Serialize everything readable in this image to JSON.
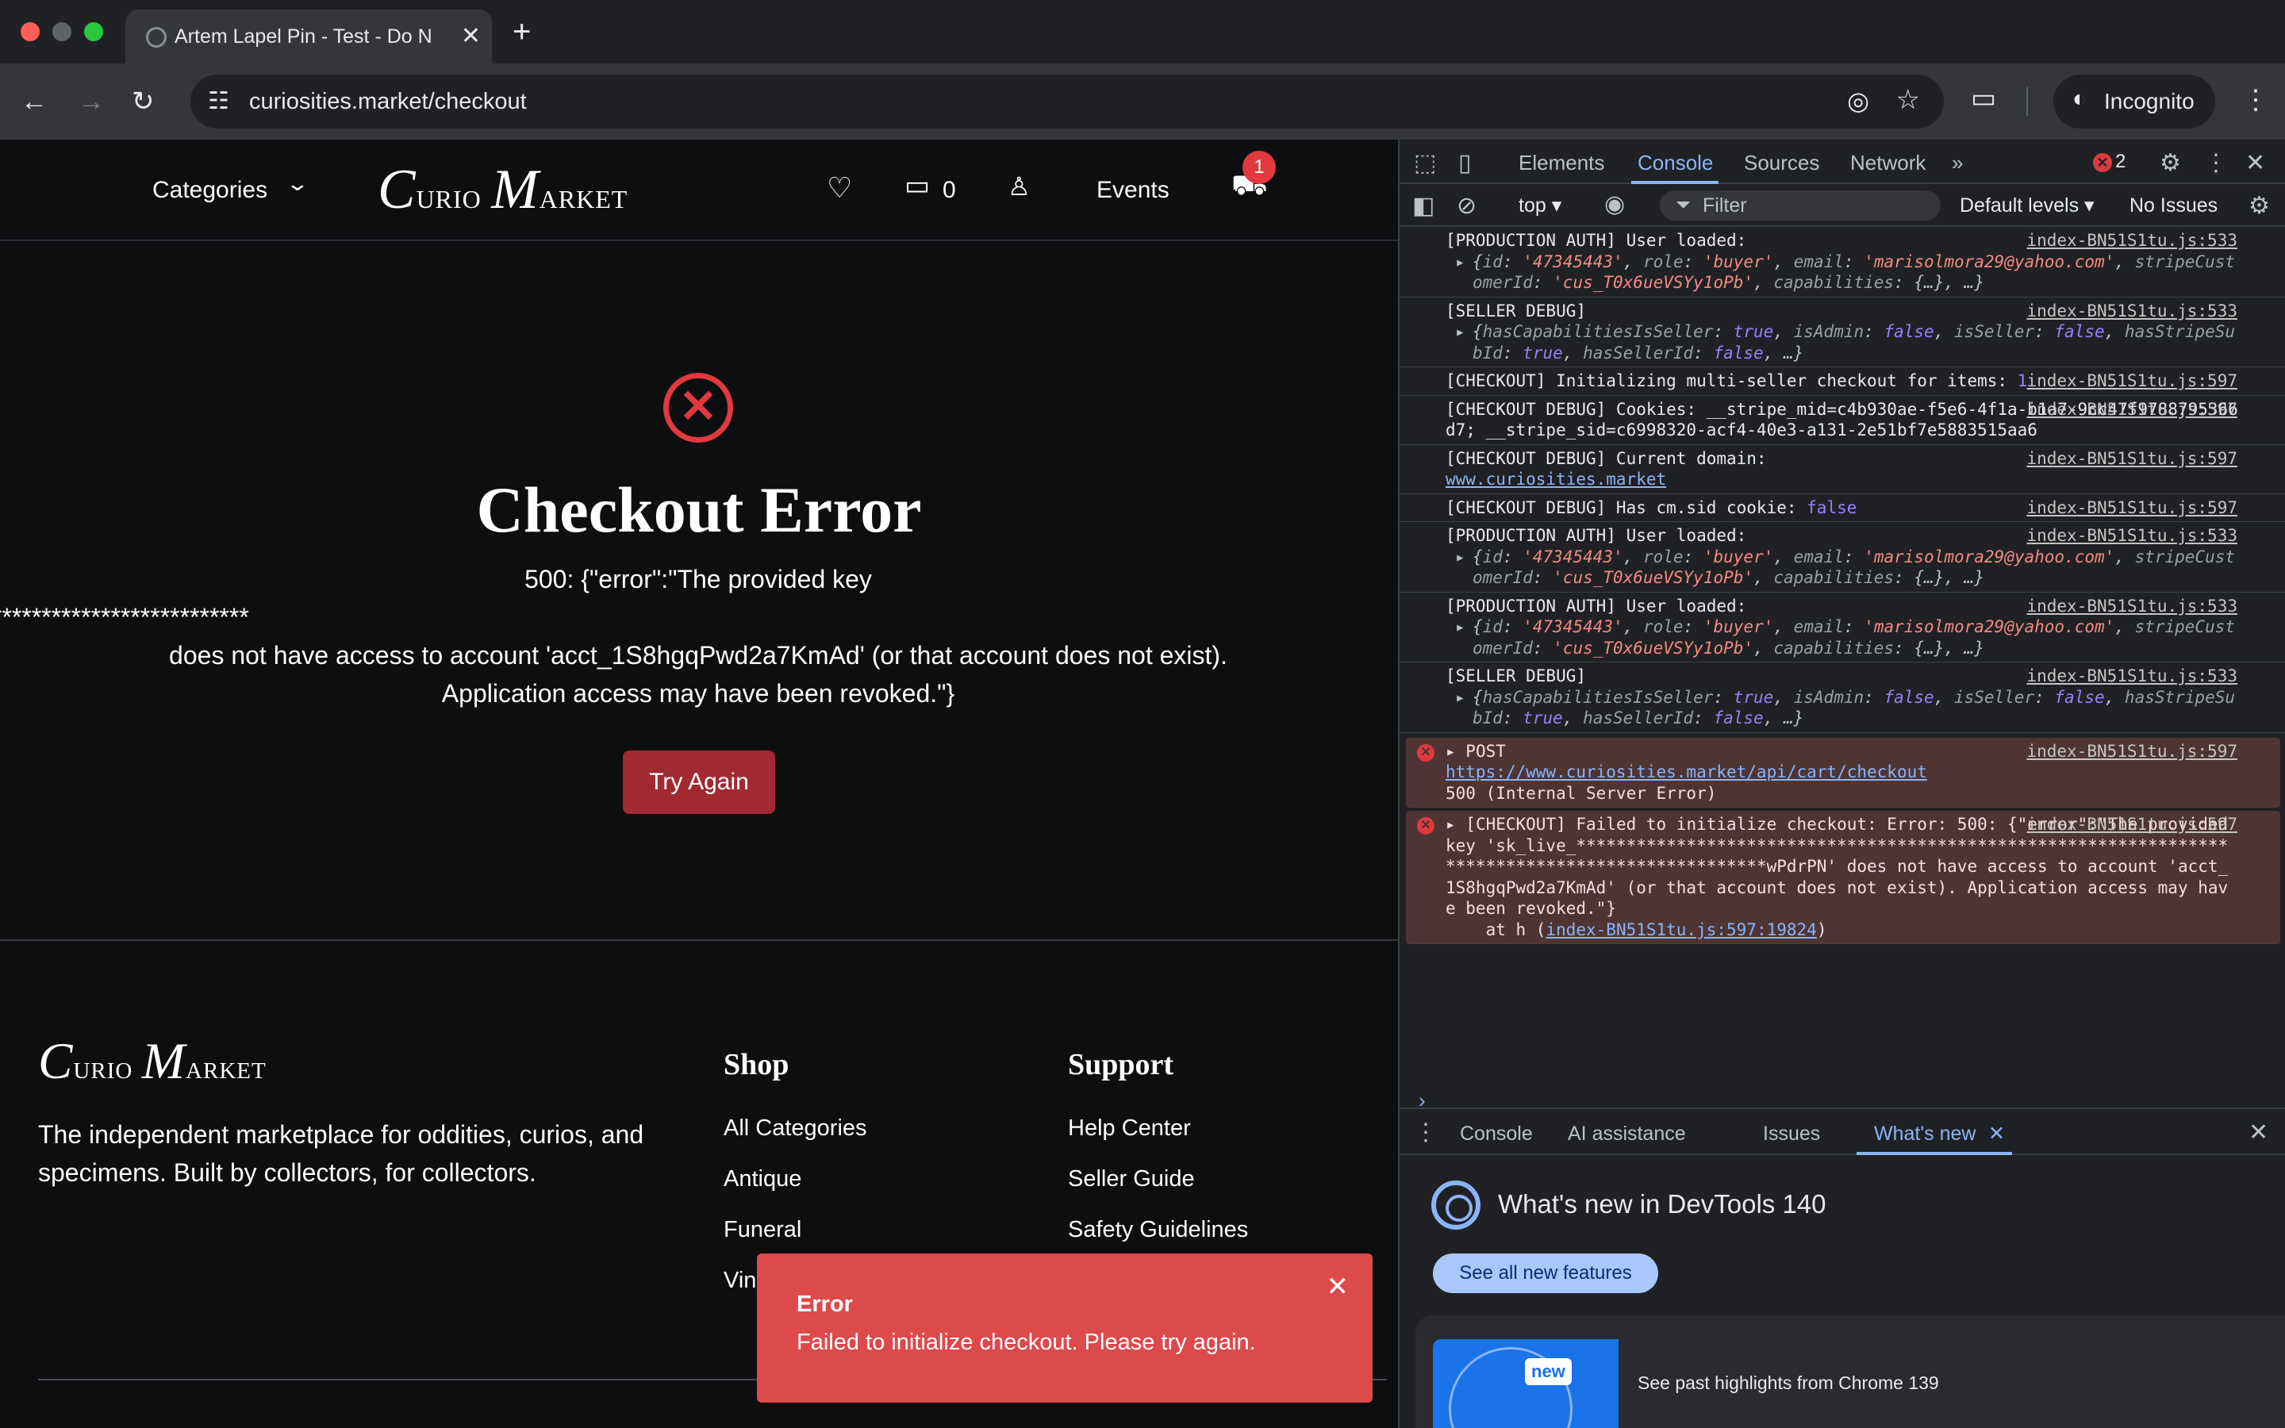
{
  "browser": {
    "tab_title": "Artem Lapel Pin - Test - Do N",
    "url": "curiosities.market/checkout",
    "incognito_label": "Incognito"
  },
  "site": {
    "nav": {
      "categories": "Categories",
      "logo": {
        "c1": "C",
        "rest1": "urio ",
        "c2": "M",
        "rest2": "arket"
      },
      "messages_count": "0",
      "events": "Events",
      "cart_count": "1"
    },
    "error": {
      "title": "Checkout Error",
      "message_line1": "500: {\"error\":\"The provided key",
      "message_line2": "'sk_live_************************************************************************************",
      "message_line3": "does not have access to account 'acct_1S8hgqPwd2a7KmAd' (or that account does not exist).",
      "message_line4": "Application access may have been revoked.\"}",
      "try_again": "Try Again"
    },
    "footer": {
      "tagline": "The independent marketplace for oddities, curios, and specimens. Built by collectors, for collectors.",
      "shop_heading": "Shop",
      "shop_links": [
        "All Categories",
        "Antique",
        "Funeral",
        "Vin"
      ],
      "support_heading": "Support",
      "support_links": [
        "Help Center",
        "Seller Guide",
        "Safety Guidelines"
      ]
    },
    "toast": {
      "title": "Error",
      "message": "Failed to initialize checkout. Please try again."
    }
  },
  "devtools": {
    "tabs": [
      "Elements",
      "Console",
      "Sources",
      "Network"
    ],
    "active_tab": "Console",
    "error_count": "2",
    "context": "top",
    "filter_placeholder": "Filter",
    "levels": "Default levels",
    "issues": "No Issues",
    "source_533": "index-BN51S1tu.js:533",
    "source_597": "index-BN51S1tu.js:597",
    "messages": {
      "m1_text": "[PRODUCTION AUTH] User loaded:",
      "m2_text": "[SELLER DEBUG]",
      "m3_text": "[CHECKOUT] Initializing multi-seller checkout for items: ",
      "m3_items": "1",
      "m4_text": "[CHECKOUT DEBUG] Cookies: __stripe_mid=c4b930ae-f5e6-4f1a-b1a7-9cc47f9788795366d7; __stripe_sid=c6998320-acf4-40e3-a131-2e51bf7e5883515aa6",
      "m5_text": "[CHECKOUT DEBUG] Current domain: ",
      "m5_domain": "www.curiosities.market",
      "m6_text": "[CHECKOUT DEBUG] Has cm.sid cookie: ",
      "m6_value": "false",
      "user_obj_id": "'47345443'",
      "user_obj_role": "'buyer'",
      "user_obj_email": "'marisolmora29@yahoo.com'",
      "user_obj_customer": "'cus_T0x6ueVSYy1oPb'",
      "post_label": "POST",
      "post_url": "https://www.curiosities.market/api/cart/checkout",
      "post_status": "500 (Internal Server Error)",
      "checkout_error": "[CHECKOUT] Failed to initialize checkout: Error: 500: {\"error\":\"The provided key 'sk_live_*************************************************************************************************wPdrPN' does not have access to account 'acct_1S8hgqPwd2a7KmAd' (or that account does not exist). Application access may have been revoked.\"}",
      "stack_prefix": "    at h (",
      "stack_link": "index-BN51S1tu.js:597:19824",
      "stack_suffix": ")"
    },
    "drawer": {
      "tabs": [
        "Console",
        "AI assistance",
        "Issues",
        "What's new"
      ],
      "whats_new_title": "What's new in DevTools 140",
      "see_all": "See all new features",
      "new_badge": "new",
      "highlight_text": "See past highlights from Chrome 139"
    }
  }
}
